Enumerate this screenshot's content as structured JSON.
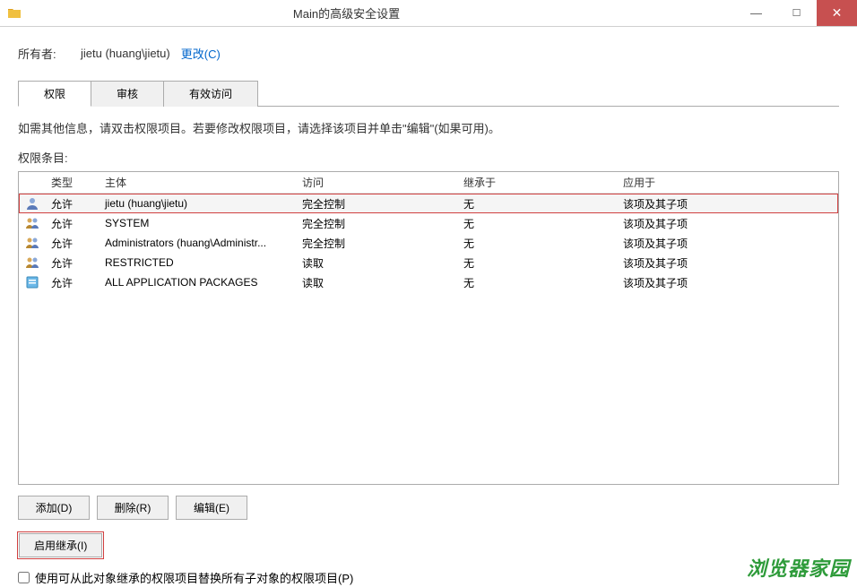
{
  "window": {
    "title": "Main的高级安全设置",
    "icon": "folder-security-icon"
  },
  "owner": {
    "label": "所有者:",
    "value": "jietu (huang\\jietu)",
    "change_link": "更改(C)"
  },
  "tabs": {
    "items": [
      {
        "label": "权限",
        "active": true
      },
      {
        "label": "审核",
        "active": false
      },
      {
        "label": "有效访问",
        "active": false
      }
    ]
  },
  "instruction": "如需其他信息，请双击权限项目。若要修改权限项目，请选择该项目并单击\"编辑\"(如果可用)。",
  "list_label": "权限条目:",
  "columns": {
    "type": "类型",
    "principal": "主体",
    "access": "访问",
    "inherited": "继承于",
    "applies": "应用于"
  },
  "entries": [
    {
      "icon": "user",
      "type": "允许",
      "principal": "jietu (huang\\jietu)",
      "access": "完全控制",
      "inherited": "无",
      "applies": "该项及其子项",
      "highlighted": true
    },
    {
      "icon": "group",
      "type": "允许",
      "principal": "SYSTEM",
      "access": "完全控制",
      "inherited": "无",
      "applies": "该项及其子项",
      "highlighted": false
    },
    {
      "icon": "group",
      "type": "允许",
      "principal": "Administrators (huang\\Administr...",
      "access": "完全控制",
      "inherited": "无",
      "applies": "该项及其子项",
      "highlighted": false
    },
    {
      "icon": "group",
      "type": "允许",
      "principal": "RESTRICTED",
      "access": "读取",
      "inherited": "无",
      "applies": "该项及其子项",
      "highlighted": false
    },
    {
      "icon": "package",
      "type": "允许",
      "principal": "ALL APPLICATION PACKAGES",
      "access": "读取",
      "inherited": "无",
      "applies": "该项及其子项",
      "highlighted": false
    }
  ],
  "buttons": {
    "add": "添加(D)",
    "remove": "删除(R)",
    "edit": "编辑(E)",
    "enable_inherit": "启用继承(I)"
  },
  "checkbox": {
    "label": "使用可从此对象继承的权限项目替换所有子对象的权限项目(P)"
  },
  "watermark": "浏览器家园"
}
